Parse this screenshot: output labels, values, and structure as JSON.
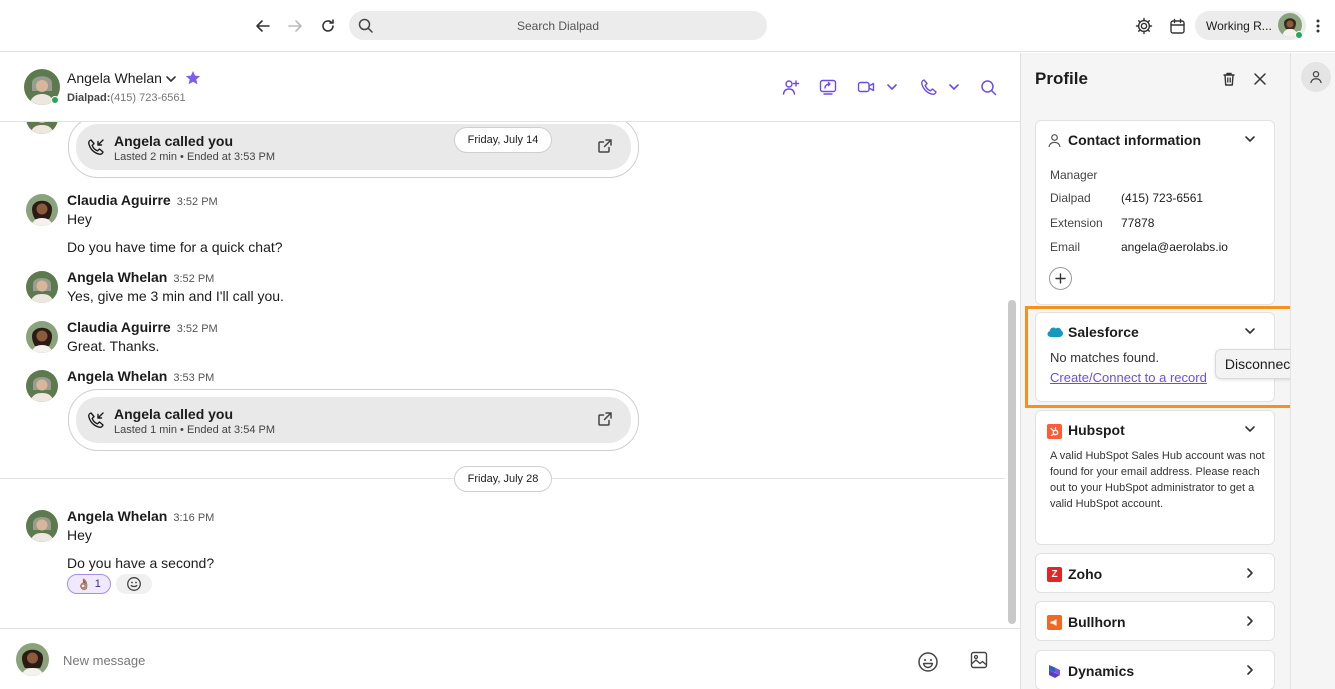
{
  "colors": {
    "accent": "#6b4de6",
    "highlight": "#f5911e",
    "online": "#22a954",
    "star": "#7d5cf0"
  },
  "topbar": {
    "search_placeholder": "Search Dialpad",
    "status_label": "Working R...",
    "icons": [
      "back-arrow-icon",
      "forward-arrow-icon",
      "refresh-icon",
      "search-icon",
      "gear-icon",
      "calendar-icon",
      "more-vertical-icon"
    ]
  },
  "chat_header": {
    "name": "Angela Whelan",
    "sub_label": "Dialpad:",
    "sub_number": "(415) 723-6561"
  },
  "messages": {
    "call1": {
      "title": "Angela called you",
      "meta": "Lasted 2 min • Ended at 3:53 PM",
      "date": "Friday, July 14"
    },
    "m1": {
      "sender": "Claudia Aguirre",
      "time": "3:52 PM",
      "lines": [
        "Hey",
        "Do you have time for a quick chat?"
      ]
    },
    "m2": {
      "sender": "Angela Whelan",
      "time": "3:52 PM",
      "lines": [
        "Yes, give me 3 min and I'll call you."
      ]
    },
    "m3": {
      "sender": "Claudia Aguirre",
      "time": "3:52 PM",
      "lines": [
        "Great. Thanks."
      ]
    },
    "m4": {
      "sender": "Angela Whelan",
      "time": "3:53 PM"
    },
    "call2": {
      "title": "Angela called you",
      "meta": "Lasted 1 min • Ended at 3:54 PM"
    },
    "date2": "Friday, July 28",
    "m5": {
      "sender": "Angela Whelan",
      "time": "3:16 PM",
      "lines": [
        "Hey",
        "Do you have a second?"
      ],
      "reaction_emoji": "👌🏽",
      "reaction_count": "1"
    }
  },
  "composer": {
    "placeholder": "New message"
  },
  "profile": {
    "title": "Profile",
    "contact": {
      "title": "Contact information",
      "rows": [
        {
          "key": "Manager",
          "value": ""
        },
        {
          "key": "Dialpad",
          "value": "(415) 723-6561"
        },
        {
          "key": "Extension",
          "value": "77878"
        },
        {
          "key": "Email",
          "value": "angela@aerolabs.io"
        }
      ]
    },
    "salesforce": {
      "title": "Salesforce",
      "no_match": "No matches found.",
      "link": "Create/Connect to a record"
    },
    "hubspot": {
      "title": "Hubspot",
      "message": "A valid HubSpot Sales Hub account was not found for your email address. Please reach out to your HubSpot administrator to get a valid HubSpot account."
    },
    "zoho": {
      "title": "Zoho",
      "logo": "Z"
    },
    "bullhorn": {
      "title": "Bullhorn"
    },
    "dynamics": {
      "title": "Dynamics"
    },
    "tooltip": "Disconnect"
  }
}
